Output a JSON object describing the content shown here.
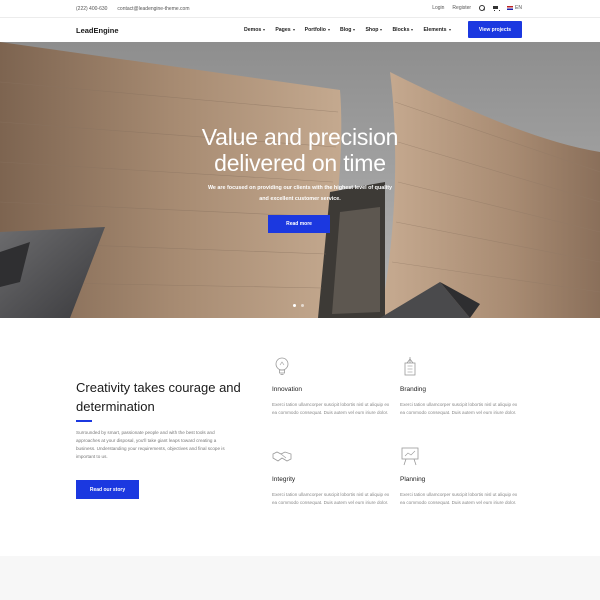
{
  "topbar": {
    "phone": "(222) 400-630",
    "email": "contact@leadengine-theme.com",
    "login": "Login",
    "register": "Register",
    "language": "EN"
  },
  "header": {
    "logo": "LeadEngine",
    "nav": [
      "Demos",
      "Pages",
      "Portfolio",
      "Blog",
      "Shop",
      "Blocks",
      "Elements"
    ],
    "cta": "View projects"
  },
  "hero": {
    "title_line1": "Value and precision",
    "title_line2": "delivered on time",
    "subtitle_line1": "We are focused on providing our clients with the highest level of quality",
    "subtitle_line2": "and excellent customer service.",
    "button": "Read more"
  },
  "intro": {
    "title": "Creativity takes courage and determination",
    "text": "Surrounded by smart, passionate people and with the best tools and approaches at your disposal, you'll take giant leaps toward creating a business. Understanding your requirements, objectives and final scope is important to us.",
    "button": "Read our story"
  },
  "features": [
    {
      "icon": "lightbulb-icon",
      "title": "Innovation",
      "text": "Exerci tation ullamcorper suscipit lobortis nisl ut aliquip ex ea commodo consequat. Duis autem vel eum iriure dolor."
    },
    {
      "icon": "building-icon",
      "title": "Branding",
      "text": "Exerci tation ullamcorper suscipit lobortis nisl ut aliquip ex ea commodo consequat. Duis autem vel eum iriure dolor."
    },
    {
      "icon": "handshake-icon",
      "title": "Integrity",
      "text": "Exerci tation ullamcorper suscipit lobortis nisl ut aliquip ex ea commodo consequat. Duis autem vel eum iriure dolor."
    },
    {
      "icon": "easel-icon",
      "title": "Planning",
      "text": "Exerci tation ullamcorper suscipit lobortis nisl ut aliquip ex ea commodo consequat. Duis autem vel eum iriure dolor."
    }
  ],
  "colors": {
    "accent": "#1b38e0",
    "text_dark": "#1a1a1a",
    "text_muted": "#888888"
  }
}
